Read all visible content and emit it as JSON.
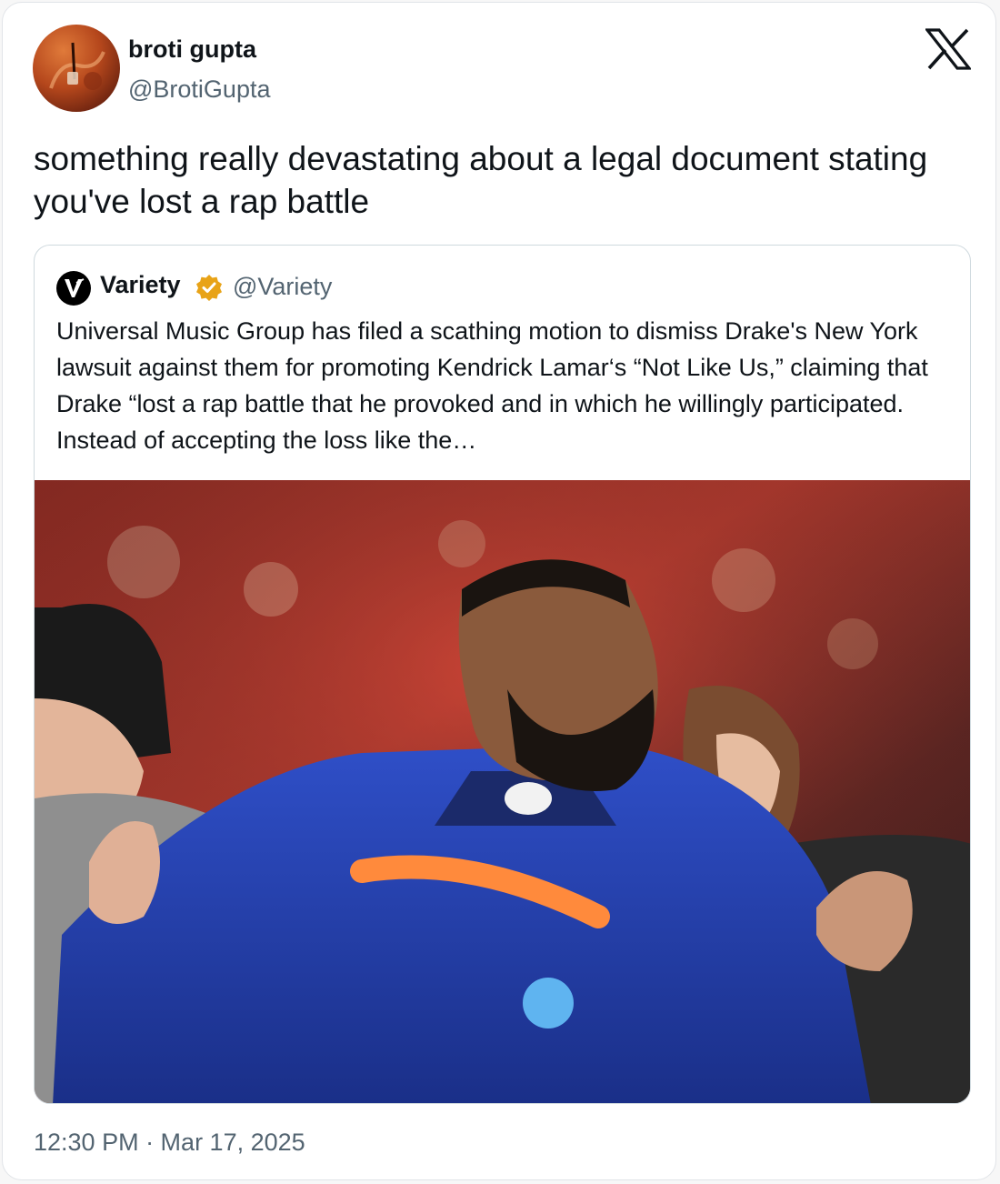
{
  "author": {
    "name": "broti gupta",
    "handle": "@BrotiGupta",
    "avatar_icon": "avatar-photo"
  },
  "platform_logo": "x-logo-icon",
  "tweet": {
    "text": "something really devastating about a legal document stating you've lost a rap battle",
    "timestamp": "12:30 PM · Mar 17, 2025"
  },
  "quoted_tweet": {
    "name": "Variety",
    "handle": "@Variety",
    "verified": true,
    "verified_color": "#e8a317",
    "text": "Universal Music Group has filed a scathing motion to dismiss Drake's New York lawsuit against them for promoting Kendrick Lamar‘s “Not Like Us,” claiming that Drake “lost a rap battle that he provoked and in which he willingly participated. Instead of accepting the loss like the…"
  },
  "colors": {
    "text_primary": "#0f1419",
    "text_secondary": "#536471",
    "border": "#cfd9de"
  }
}
